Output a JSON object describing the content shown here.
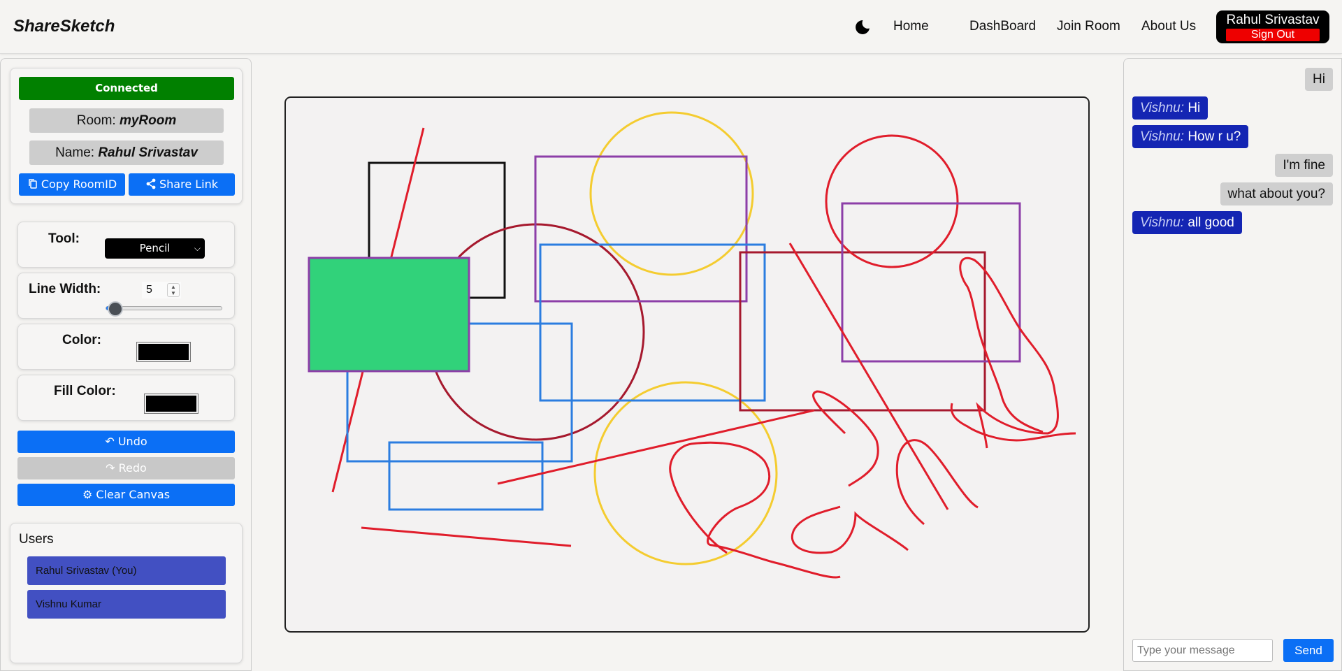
{
  "navbar": {
    "brand": "ShareSketch",
    "theme_icon": "moon-icon",
    "links": [
      "Home",
      "DashBoard",
      "Join Room",
      "About Us"
    ],
    "user_name": "Rahul Srivastav",
    "sign_out": "Sign Out"
  },
  "room": {
    "status": "Connected",
    "status_color": "#018000",
    "room_label": "Room:",
    "room_value": "myRoom",
    "name_label": "Name:",
    "name_value": "Rahul Srivastav",
    "copy_button": "Copy RoomID",
    "share_button": "Share Link"
  },
  "tools": {
    "tool_label": "Tool:",
    "tool_value": "Pencil",
    "line_width_label": "Line Width:",
    "line_width": "5",
    "line_width_fraction": 0.05,
    "color_label": "Color:",
    "color_value": "#000000",
    "fill_label": "Fill Color:",
    "fill_value": "#000000",
    "undo": "Undo",
    "redo": "Redo",
    "clear": "Clear Canvas"
  },
  "users": {
    "title": "Users",
    "list": [
      "Rahul Srivastav (You)",
      "Vishnu Kumar"
    ]
  },
  "chat": {
    "messages": [
      {
        "from": "",
        "text": "Hi",
        "mine": true
      },
      {
        "from": "Vishnu:",
        "text": "Hi",
        "mine": false
      },
      {
        "from": "Vishnu:",
        "text": "How r u?",
        "mine": false
      },
      {
        "from": "",
        "text": "I'm fine",
        "mine": true
      },
      {
        "from": "",
        "text": "what about you?",
        "mine": true
      },
      {
        "from": "Vishnu:",
        "text": "all good",
        "mine": false
      }
    ],
    "placeholder": "Type your message",
    "send": "Send"
  },
  "colors": {
    "accent": "#0b6ff5",
    "other_message": "#1425b3",
    "user_item": "#4250c2",
    "sign_out": "#ee0000"
  }
}
